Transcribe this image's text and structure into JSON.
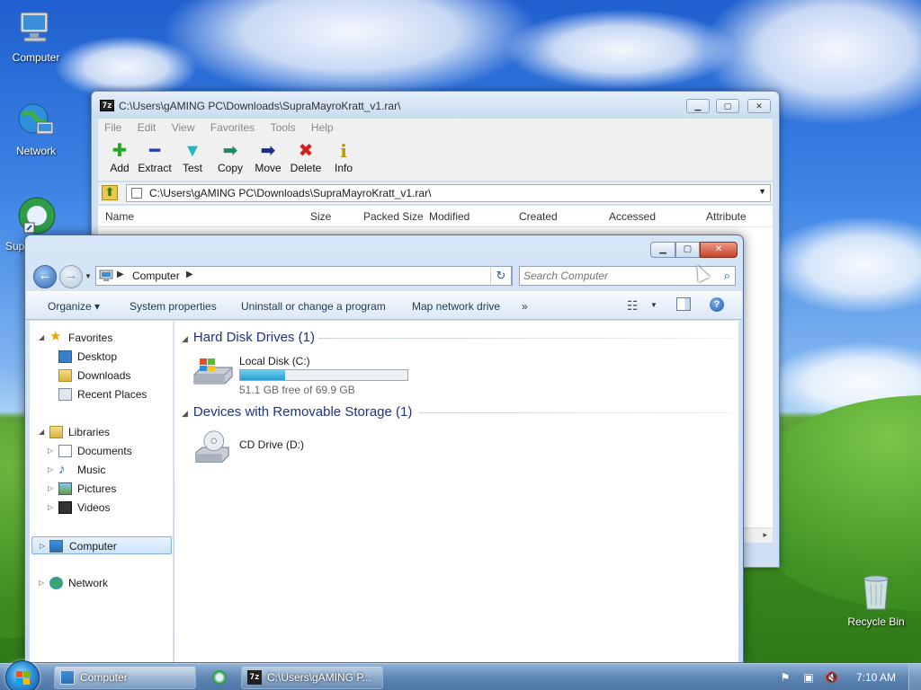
{
  "desktop": {
    "icons": [
      {
        "label": "Computer",
        "icon": "computer-icon"
      },
      {
        "label": "Network",
        "icon": "network-icon"
      },
      {
        "label": "Sup",
        "icon": "supramayrokratt-icon"
      },
      {
        "label": "Recycle Bin",
        "icon": "recycle-bin-icon"
      }
    ]
  },
  "zip": {
    "title": "C:\\Users\\gAMING PC\\Downloads\\SupraMayroKratt_v1.rar\\",
    "app_icon": "7z",
    "menu": [
      "File",
      "Edit",
      "View",
      "Favorites",
      "Tools",
      "Help"
    ],
    "toolbar": [
      {
        "label": "Add",
        "icon": "add-icon",
        "glyph": "✚",
        "color": "#22a822"
      },
      {
        "label": "Extract",
        "icon": "extract-icon",
        "glyph": "━",
        "color": "#1a3fb8"
      },
      {
        "label": "Test",
        "icon": "test-icon",
        "glyph": "▼",
        "color": "#21b5c7"
      },
      {
        "label": "Copy",
        "icon": "copy-icon",
        "glyph": "➡",
        "color": "#1d8a6a"
      },
      {
        "label": "Move",
        "icon": "move-icon",
        "glyph": "➡",
        "color": "#1a2f8c"
      },
      {
        "label": "Delete",
        "icon": "delete-icon",
        "glyph": "✖",
        "color": "#d81d1d"
      },
      {
        "label": "Info",
        "icon": "info-icon",
        "glyph": "i",
        "color": "#b89a00"
      }
    ],
    "address": "C:\\Users\\gAMING PC\\Downloads\\SupraMayroKratt_v1.rar\\",
    "columns": [
      "Name",
      "Size",
      "Packed Size",
      "Modified",
      "Created",
      "Accessed",
      "Attribute"
    ]
  },
  "explorer": {
    "breadcrumb": "Computer",
    "search_placeholder": "Search Computer",
    "commands": [
      "Organize ▾",
      "System properties",
      "Uninstall or change a program",
      "Map network drive",
      "»"
    ],
    "nav": {
      "favorites": "Favorites",
      "desktop": "Desktop",
      "downloads": "Downloads",
      "recent": "Recent Places",
      "libraries": "Libraries",
      "documents": "Documents",
      "music": "Music",
      "pictures": "Pictures",
      "videos": "Videos",
      "computer": "Computer",
      "network": "Network"
    },
    "groups": {
      "hdd_title": "Hard Disk Drives (1)",
      "removable_title": "Devices with Removable Storage (1)"
    },
    "drives": {
      "c_name": "Local Disk (C:)",
      "c_free": "51.1 GB free of 69.9 GB",
      "c_used_fraction": 0.269,
      "d_name": "CD Drive (D:)"
    }
  },
  "taskbar": {
    "buttons": [
      {
        "label": "Computer",
        "icon": "explorer-icon"
      },
      {
        "label": "C:\\Users\\gAMING P...",
        "icon": "7zip-icon"
      }
    ],
    "clock": "7:10 AM",
    "tray": [
      "flag-icon",
      "network-tray-icon",
      "volume-muted-icon"
    ]
  }
}
